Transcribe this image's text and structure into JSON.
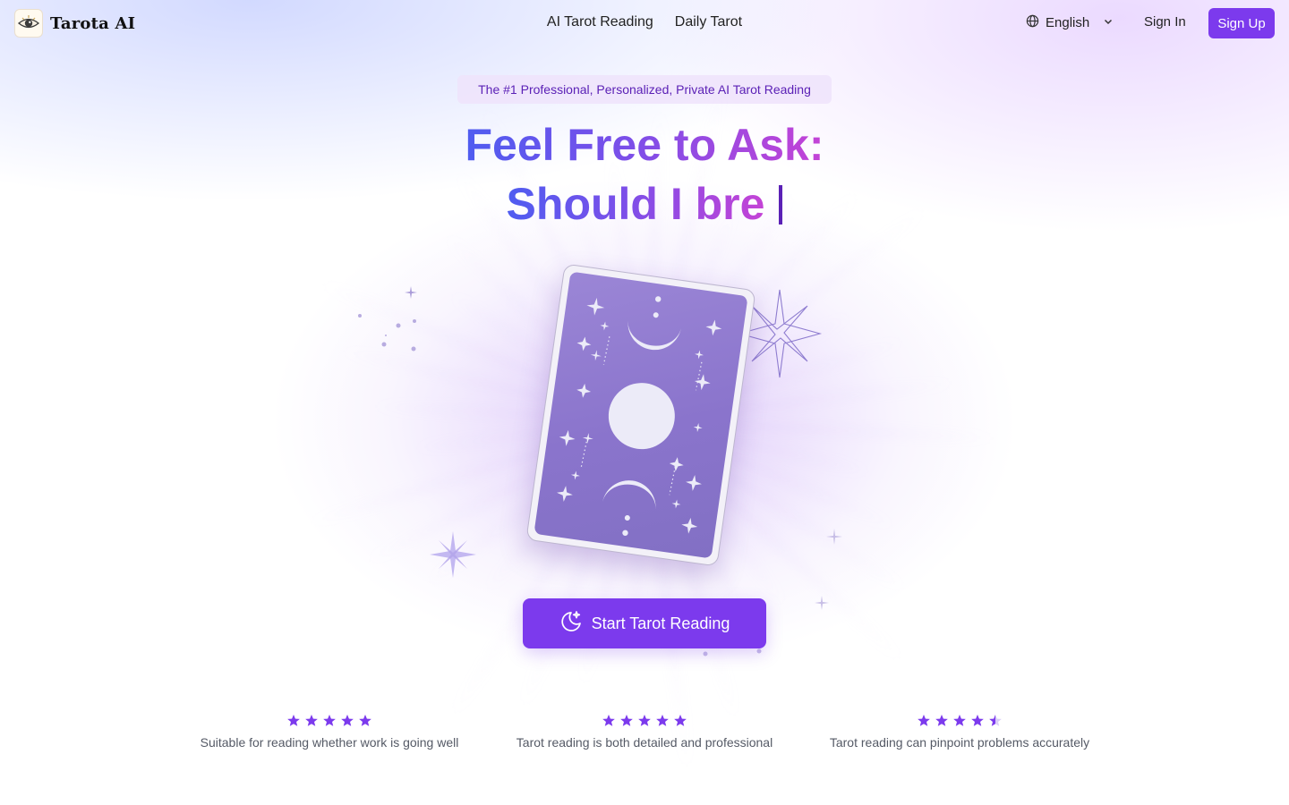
{
  "brand": {
    "name": "Tarota AI",
    "logo_icon": "eye-icon"
  },
  "nav": {
    "items": [
      {
        "label": "AI Tarot Reading"
      },
      {
        "label": "Daily Tarot"
      }
    ]
  },
  "header": {
    "language": {
      "icon": "globe-icon",
      "selected": "English"
    },
    "sign_in": "Sign In",
    "sign_up": "Sign Up"
  },
  "hero": {
    "tagline": "The #1 Professional, Personalized, Private AI Tarot Reading",
    "headline_line1": "Feel Free to Ask:",
    "headline_line2": "Should I bre",
    "cta_label": "Start Tarot Reading",
    "cta_icon": "moon-sparkle-icon"
  },
  "reviews": [
    {
      "rating": 5,
      "text": "Suitable for reading whether work is going well"
    },
    {
      "rating": 5,
      "text": "Tarot reading is both detailed and professional"
    },
    {
      "rating": 4.5,
      "text": "Tarot reading can pinpoint problems accurately"
    }
  ],
  "colors": {
    "accent": "#7c3aed",
    "star": "#7c3aed",
    "card": "#8f7bd0",
    "gradient_start": "#4f5cf0",
    "gradient_end": "#c443d6"
  }
}
